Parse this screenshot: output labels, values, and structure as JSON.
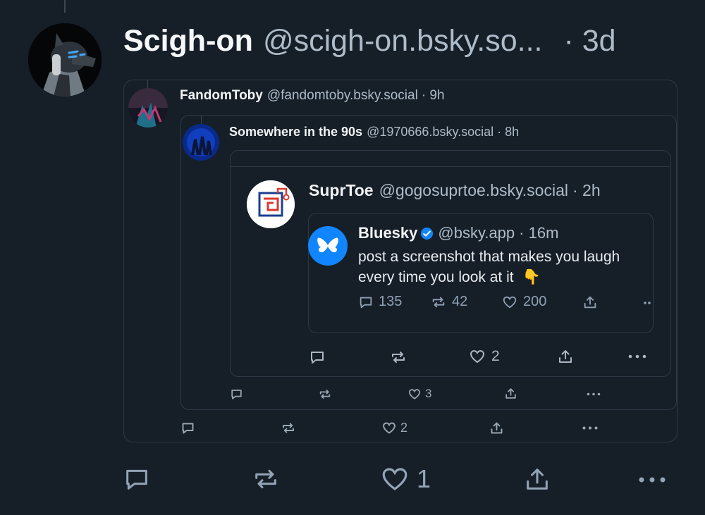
{
  "outer_post": {
    "author_name": "Scigh-on",
    "handle": "@scigh-on.bsky.so...",
    "sep_time": "· 3d",
    "actions": {
      "reply_count": "",
      "repost_count": "",
      "like_count": "1"
    }
  },
  "quote1": {
    "author_name": "FandomToby",
    "handle": "@fandomtoby.bsky.social",
    "sep_time": "· 9h",
    "actions": {
      "like_count": "2"
    }
  },
  "quote2": {
    "author_name": "Somewhere in the 90s",
    "handle": "@1970666.bsky.social",
    "sep_time": "· 8h",
    "actions": {
      "like_count": "3"
    }
  },
  "quote3": {
    "author_name": "SuprToe",
    "handle": "@gogosuprtoe.bsky.social",
    "sep_time": "· 2h",
    "actions": {
      "like_count": "2"
    }
  },
  "quote4": {
    "author_name": "Bluesky",
    "handle": "@bsky.app",
    "sep_time": "· 16m",
    "text_line1": "post a screenshot that makes you laugh",
    "text_line2": "every time you look at it",
    "emoji": "👇",
    "actions": {
      "reply_count": "135",
      "repost_count": "42",
      "like_count": "200"
    }
  },
  "colors": {
    "background": "#161e27",
    "border": "#2e3a48",
    "verified_blue": "#1185fe",
    "muted_text": "#aebbc9"
  }
}
